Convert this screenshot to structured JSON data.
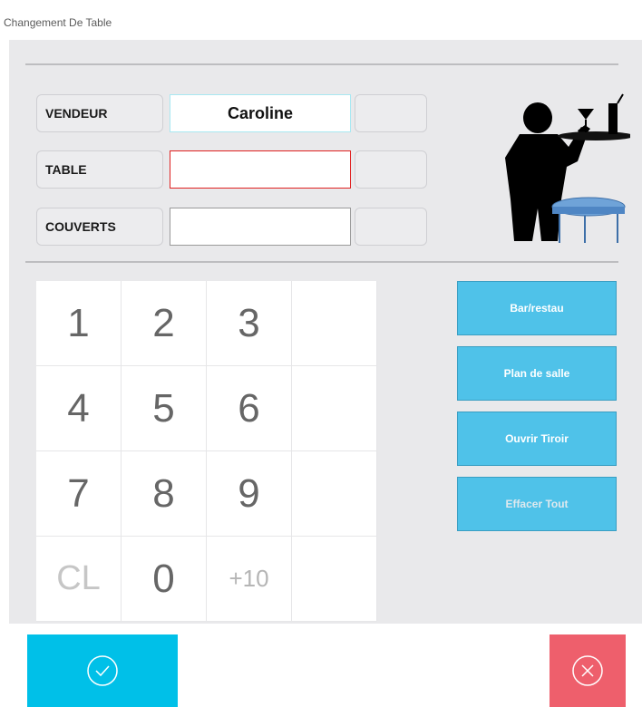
{
  "window": {
    "title": "Changement De Table"
  },
  "fields": {
    "vendeur": {
      "label": "VENDEUR",
      "value": "Caroline"
    },
    "table": {
      "label": "TABLE",
      "value": ""
    },
    "couverts": {
      "label": "COUVERTS",
      "value": ""
    }
  },
  "keypad": {
    "keys": [
      "1",
      "2",
      "3",
      "",
      "4",
      "5",
      "6",
      "",
      "7",
      "8",
      "9",
      "",
      "CL",
      "0",
      "+10",
      ""
    ]
  },
  "actions": {
    "bar_restau": "Bar/restau",
    "plan_de_salle": "Plan de salle",
    "ouvrir_tiroir": "Ouvrir Tiroir",
    "effacer_tout": "Effacer Tout"
  },
  "colors": {
    "ok": "#00c0e8",
    "cancel": "#ee5f6c",
    "action": "#4fc2e9",
    "table_border": "#e02020",
    "vendeur_border": "#a8e8f2"
  }
}
